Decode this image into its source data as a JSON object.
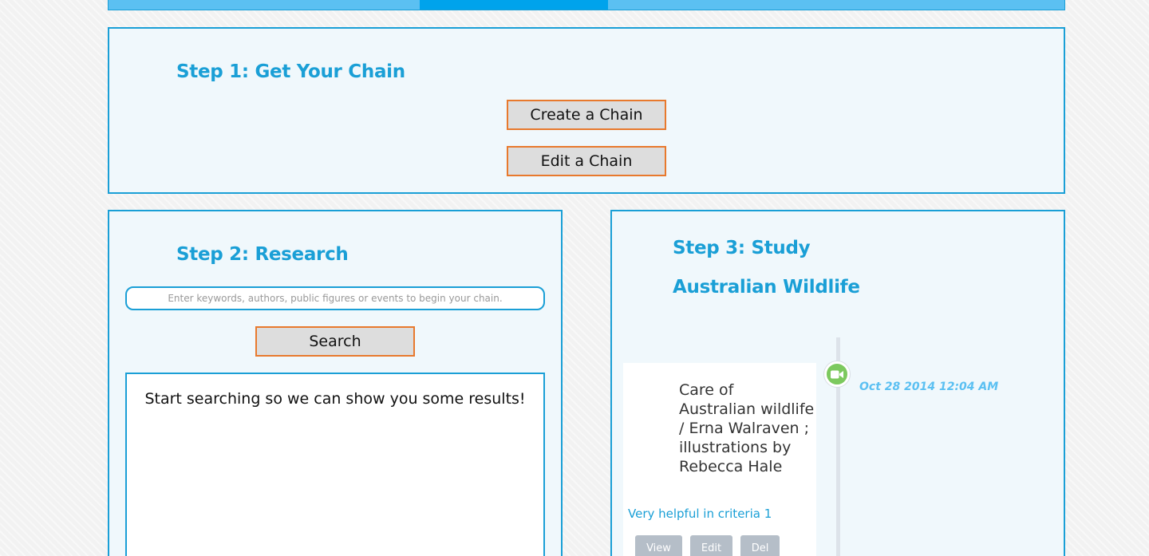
{
  "step1": {
    "title": "Step 1: Get Your Chain",
    "create_label": "Create a Chain",
    "edit_label": "Edit a Chain"
  },
  "step2": {
    "title": "Step 2: Research",
    "search_placeholder": "Enter keywords, authors, public figures or events to begin your chain.",
    "search_value": "",
    "search_label": "Search",
    "results_message": "Start searching so we can show you some results!"
  },
  "step3": {
    "title": "Step 3: Study",
    "subtitle": "Australian Wildlife",
    "item": {
      "icon": "video-camera-icon",
      "icon_color": "#7cc95e",
      "date": "Oct 28 2014 12:04 AM",
      "title": "Care of Australian wildlife / Erna Walraven ; illustrations by Rebecca Hale",
      "note": "Very helpful in criteria 1",
      "actions": {
        "view": "View",
        "edit": "Edit",
        "del": "Del"
      }
    }
  },
  "colors": {
    "accent": "#1a9fd6",
    "button_border": "#e8792d",
    "button_bg": "#dddddd",
    "nav_bar": "#5bc0f2",
    "nav_active": "#00a3ec"
  }
}
